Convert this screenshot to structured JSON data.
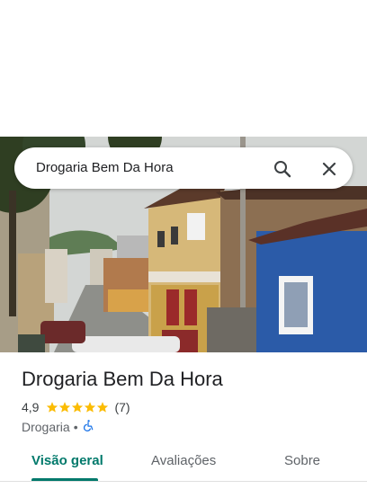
{
  "search": {
    "query": "Drogaria Bem Da Hora"
  },
  "place": {
    "name": "Drogaria Bem Da Hora",
    "rating": "4,9",
    "rating_value": 4.9,
    "review_count": "(7)",
    "category": "Drogaria",
    "separator": "•"
  },
  "tabs": [
    {
      "label": "Visão geral",
      "active": true
    },
    {
      "label": "Avaliações",
      "active": false
    },
    {
      "label": "Sobre",
      "active": false
    }
  ],
  "colors": {
    "accent": "#00796b",
    "star": "#fbbc04",
    "accessibility_icon": "#1a73e8"
  }
}
